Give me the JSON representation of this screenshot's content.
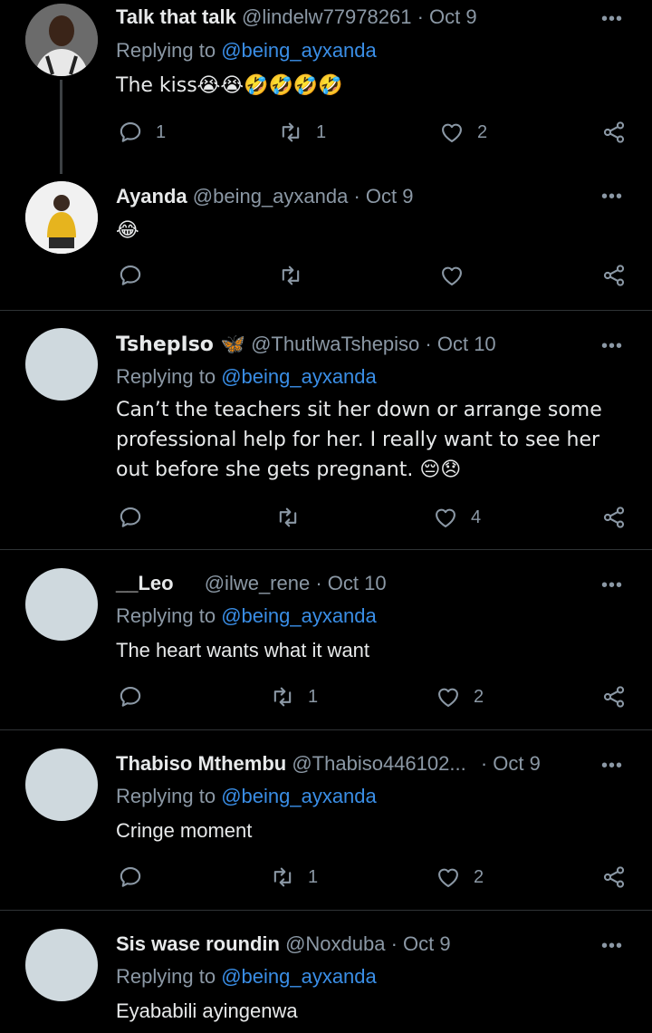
{
  "tweets": [
    {
      "name": "Talk that talk",
      "handle": "@lindelw77978261",
      "date": "Oct 9",
      "replying_label": "Replying to ",
      "mention": "@being_ayxanda",
      "text": "The kiss😭😭🤣🤣🤣🤣",
      "replies": "1",
      "retweets": "1",
      "likes": "2"
    },
    {
      "name": "Ayanda",
      "handle": "@being_ayxanda",
      "date": "Oct 9",
      "text": "😂",
      "replies": "",
      "retweets": "",
      "likes": ""
    },
    {
      "name": "TshepIso 🦋",
      "handle": "@ThutlwaTshepiso",
      "date": "Oct 10",
      "replying_label": "Replying to ",
      "mention": "@being_ayxanda",
      "text": "Can’t the teachers sit her down or arrange some professional help for her. I really want to see her out before she gets pregnant. 😔😞",
      "replies": "",
      "retweets": "",
      "likes": "4"
    },
    {
      "name": "__Leo",
      "handle": "@ilwe_rene",
      "date": "Oct 10",
      "replying_label": "Replying to ",
      "mention": "@being_ayxanda",
      "text": "The heart wants what it want",
      "replies": "",
      "retweets": "1",
      "likes": "2"
    },
    {
      "name": "Thabiso Mthembu",
      "handle": "@Thabiso446102...",
      "date": "Oct 9",
      "replying_label": "Replying to ",
      "mention": "@being_ayxanda",
      "text": "Cringe moment",
      "replies": "",
      "retweets": "1",
      "likes": "2"
    },
    {
      "name": "Sis wase roundin",
      "handle": "@Noxduba",
      "date": "Oct 9",
      "replying_label": "Replying to ",
      "mention": "@being_ayxanda",
      "text": "Eyababili ayingenwa"
    }
  ],
  "sep": " · ",
  "more_label": "•••",
  "icons": {
    "reply": "reply-icon",
    "retweet": "retweet-icon",
    "like": "heart-icon",
    "share": "share-icon",
    "more": "more-icon"
  },
  "colors": {
    "background": "#000000",
    "mention": "#3a8ee6",
    "muted": "#8b98a5",
    "text": "#e7e9ea"
  }
}
